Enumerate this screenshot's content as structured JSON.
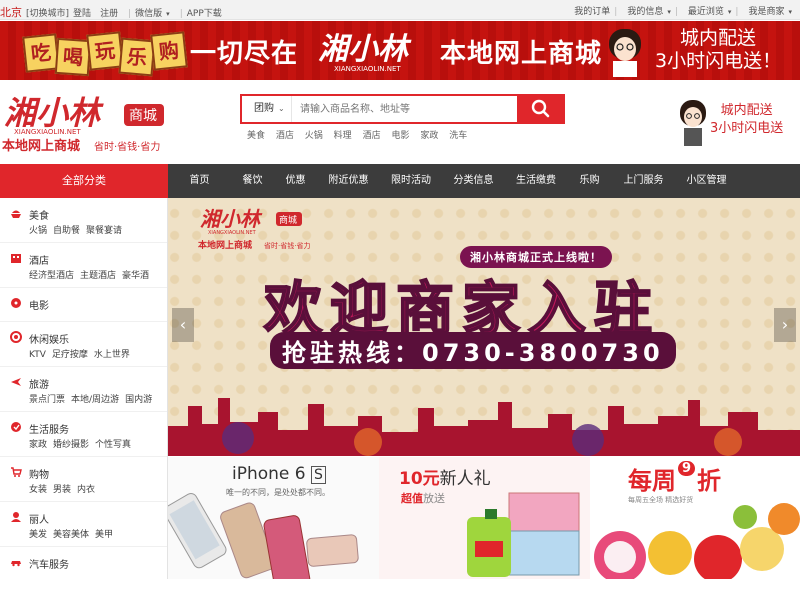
{
  "topbar": {
    "city": "北京",
    "switch_city": "[切换城市]",
    "login": "登陆",
    "register": "注册",
    "wechat": "微信版",
    "app": "APP下载",
    "my_orders": "我的订单",
    "my_info": "我的信息",
    "recent": "最近浏览",
    "merchant": "我是商家"
  },
  "banner": {
    "tags": [
      "吃",
      "喝",
      "玩",
      "乐",
      "购"
    ],
    "slogan_left": "一切尽在",
    "slogan_right": "本地网上商城",
    "logo_cn": "湘小林",
    "logo_en": "XIANGXIAOLIN.NET",
    "delivery_line1": "城内配送",
    "delivery_line2": "3小时闪电送！"
  },
  "header": {
    "logo_cn": "湘小林",
    "logo_en": "XIANGXIAOLIN.NET",
    "logo_badge": "商城",
    "logo_sub": "本地网上商城",
    "logo_tagline": "省时·省钱·省力",
    "search_scope": "团购",
    "search_placeholder": "请输入商品名称、地址等",
    "hot_keywords": [
      "美食",
      "酒店",
      "火锅",
      "料理",
      "酒店",
      "电影",
      "家政",
      "洗车"
    ],
    "delivery_line1": "城内配送",
    "delivery_line2": "3小时闪电送"
  },
  "nav": {
    "all_categories": "全部分类",
    "items": [
      "首页",
      "餐饮",
      "优惠",
      "附近优惠",
      "限时活动",
      "分类信息",
      "生活缴费",
      "乐购",
      "上门服务",
      "小区管理"
    ]
  },
  "sidebar": {
    "categories": [
      {
        "title": "美食",
        "icon": "food-icon",
        "subs": [
          "火锅",
          "自助餐",
          "聚餐宴请"
        ]
      },
      {
        "title": "酒店",
        "icon": "hotel-icon",
        "subs": [
          "经济型酒店",
          "主题酒店",
          "豪华酒"
        ]
      },
      {
        "title": "电影",
        "icon": "movie-icon",
        "subs": []
      },
      {
        "title": "休闲娱乐",
        "icon": "leisure-icon",
        "subs": [
          "KTV",
          "足疗按摩",
          "水上世界"
        ]
      },
      {
        "title": "旅游",
        "icon": "plane-icon",
        "subs": [
          "景点门票",
          "本地/周边游",
          "国内游"
        ]
      },
      {
        "title": "生活服务",
        "icon": "service-icon",
        "subs": [
          "家政",
          "婚纱摄影",
          "个性写真"
        ]
      },
      {
        "title": "购物",
        "icon": "cart-icon",
        "subs": [
          "女装",
          "男装",
          "内衣"
        ]
      },
      {
        "title": "丽人",
        "icon": "beauty-icon",
        "subs": [
          "美发",
          "美容美体",
          "美甲"
        ]
      },
      {
        "title": "汽车服务",
        "icon": "car-icon",
        "subs": []
      }
    ]
  },
  "slider": {
    "logo_cn": "湘小林",
    "logo_badge": "商城",
    "logo_en": "XIANGXIAOLIN.NET",
    "logo_sub": "本地网上商城",
    "logo_tagline": "省时·省钱·省力",
    "launch_text": "湘小林商城正式上线啦！",
    "headline": "欢迎商家入驻",
    "hotline": "抢驻热线：0730-3800730",
    "prev": "‹",
    "next": "›"
  },
  "promos": {
    "iphone_title": "iPhone 6",
    "iphone_badge": "S",
    "iphone_sub": "唯一的不同，是处处都不同。",
    "gift_title_num": "10元",
    "gift_title": "新人礼",
    "gift_sub_a": "超值",
    "gift_sub_b": "放送",
    "weekly_a": "每周",
    "weekly_num": "9",
    "weekly_b": "折",
    "weekly_sub": "每周五全场 精选好货"
  },
  "colors": {
    "brand_red": "#e0262b",
    "nav_bg": "#3c3c3c",
    "banner_bg": "#c5130f"
  }
}
